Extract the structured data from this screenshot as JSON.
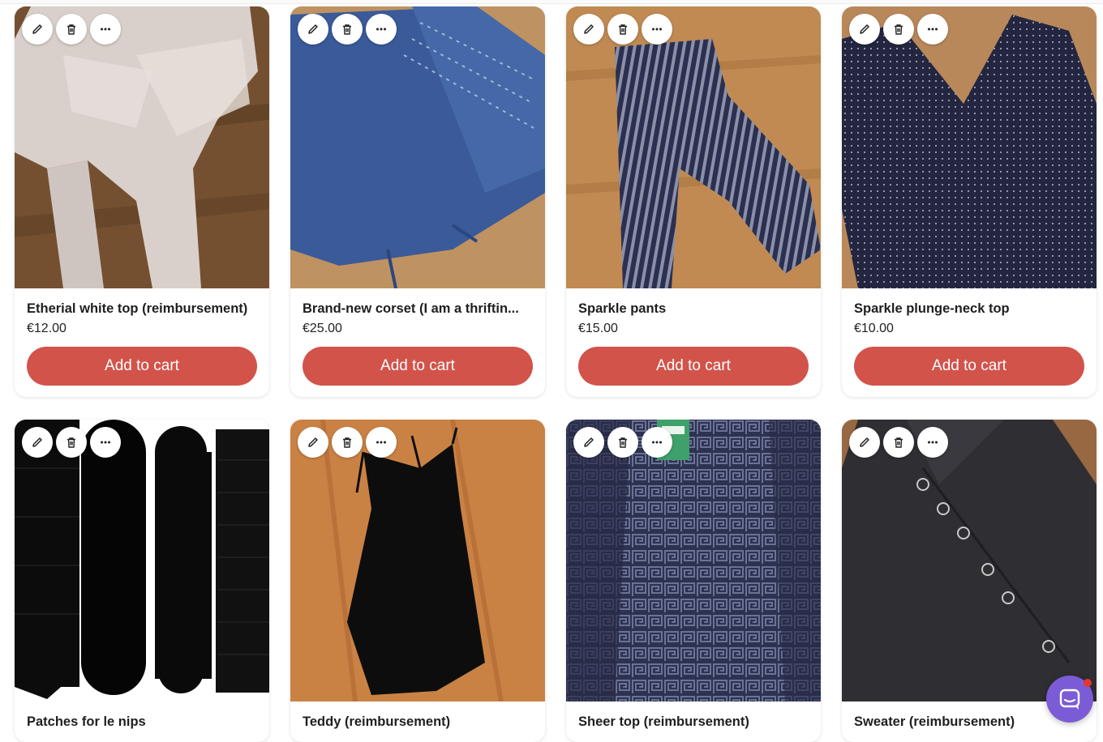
{
  "products": [
    {
      "title": "Etherial white top (reimbursement)",
      "price": "€12.00",
      "button": "Add to cart",
      "image": "white-sheer-top-photo"
    },
    {
      "title": "Brand-new corset (I am a thriftin...",
      "price": "€25.00",
      "button": "Add to cart",
      "image": "blue-corset-photo"
    },
    {
      "title": "Sparkle pants",
      "price": "€15.00",
      "button": "Add to cart",
      "image": "striped-pants-photo"
    },
    {
      "title": "Sparkle plunge-neck top",
      "price": "€10.00",
      "button": "Add to cart",
      "image": "sparkle-top-photo"
    },
    {
      "title": "Patches for le nips",
      "image": "nipple-patches-photo"
    },
    {
      "title": "Teddy (reimbursement)",
      "image": "black-teddy-photo"
    },
    {
      "title": "Sheer top (reimbursement)",
      "image": "sheer-pattern-top-photo"
    },
    {
      "title": "Sweater (reimbursement)",
      "image": "black-sweater-photo"
    }
  ],
  "icons": {
    "edit": "pencil-icon",
    "delete": "trash-icon",
    "more": "ellipsis-icon",
    "chat": "chat-bubble-icon"
  },
  "colors": {
    "accent": "#d2534a",
    "chat": "#7b5cd6"
  }
}
